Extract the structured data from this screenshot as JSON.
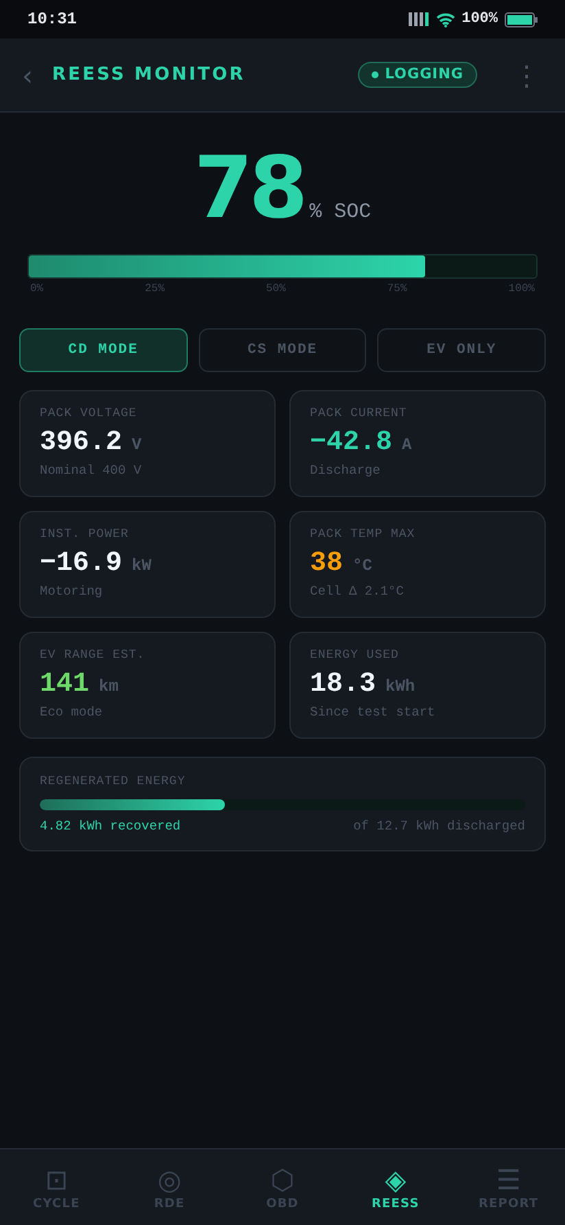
{
  "status_bar": {
    "time": "10:31",
    "battery": "100%"
  },
  "header": {
    "back": "‹",
    "title": "REESS MONITOR",
    "badge": "LOGGING",
    "menu": "⋮"
  },
  "soc": {
    "value": "78",
    "unit": "% SOC",
    "level": 0.78,
    "ticks": [
      "0%",
      "25%",
      "50%",
      "75%",
      "100%"
    ]
  },
  "modes": [
    {
      "label": "CD MODE",
      "selected": true
    },
    {
      "label": "CS MODE",
      "selected": false
    },
    {
      "label": "EV ONLY",
      "selected": false
    }
  ],
  "metrics": [
    {
      "label": "PACK VOLTAGE",
      "value": "396.2",
      "unit": "V",
      "note": "Nominal 400 V",
      "color": "#f1f5f9"
    },
    {
      "label": "PACK CURRENT",
      "value": "−42.8",
      "unit": "A",
      "note": "Discharge",
      "color": "#2dd4aa"
    },
    {
      "label": "INST. POWER",
      "value": "−16.9",
      "unit": "kW",
      "note": "Motoring",
      "color": "#f1f5f9"
    },
    {
      "label": "PACK TEMP MAX",
      "value": "38",
      "unit": "°C",
      "note": "Cell Δ 2.1°C",
      "color": "#f59e0b"
    },
    {
      "label": "EV RANGE EST.",
      "value": "141",
      "unit": "km",
      "note": "Eco mode",
      "color": "#6fd86a"
    },
    {
      "label": "ENERGY USED",
      "value": "18.3",
      "unit": "kWh",
      "note": "Since test start",
      "color": "#f1f5f9"
    }
  ],
  "regen": {
    "label": "REGENERATED ENERGY",
    "level": 0.38,
    "recovered": "4.82 kWh recovered",
    "total": "of 12.7 kWh discharged"
  },
  "nav": [
    {
      "icon": "⊡",
      "label": "CYCLE",
      "selected": false
    },
    {
      "icon": "◎",
      "label": "RDE",
      "selected": false
    },
    {
      "icon": "⬡",
      "label": "OBD",
      "selected": false
    },
    {
      "icon": "◈",
      "label": "REESS",
      "selected": true
    },
    {
      "icon": "☰",
      "label": "REPORT",
      "selected": false
    }
  ]
}
